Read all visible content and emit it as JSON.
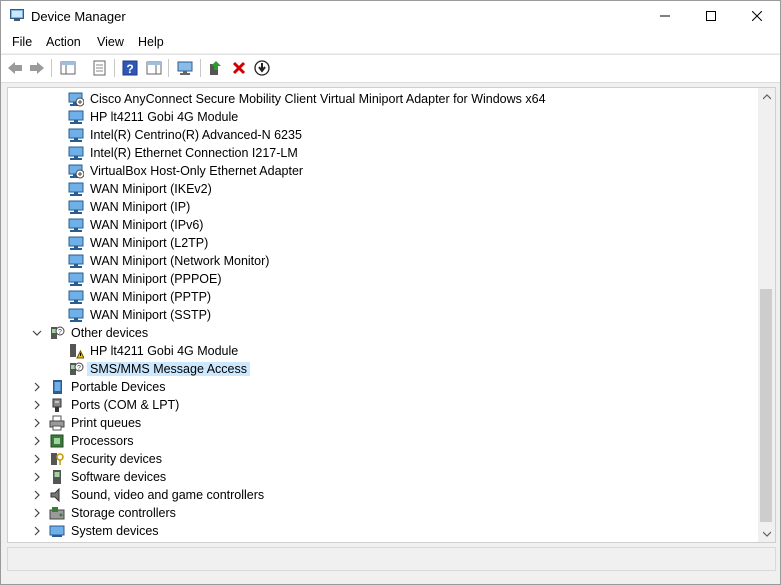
{
  "window": {
    "title": "Device Manager"
  },
  "menu": {
    "file": "File",
    "action": "Action",
    "view": "View",
    "help": "Help"
  },
  "toolbar": {
    "buttons": [
      "back-arrow-icon",
      "forward-arrow-icon",
      "show-hide-console-tree-icon",
      "properties-icon",
      "help-icon",
      "action-pane-icon",
      "scan-hardware-icon",
      "update-driver-icon",
      "uninstall-icon",
      "disable-device-icon"
    ]
  },
  "tree": {
    "network_adapters": [
      "Cisco AnyConnect Secure Mobility Client Virtual Miniport Adapter for Windows x64",
      "HP lt4211 Gobi 4G Module",
      "Intel(R) Centrino(R) Advanced-N 6235",
      "Intel(R) Ethernet Connection I217-LM",
      "VirtualBox Host-Only Ethernet Adapter",
      "WAN Miniport (IKEv2)",
      "WAN Miniport (IP)",
      "WAN Miniport (IPv6)",
      "WAN Miniport (L2TP)",
      "WAN Miniport (Network Monitor)",
      "WAN Miniport (PPPOE)",
      "WAN Miniport (PPTP)",
      "WAN Miniport (SSTP)"
    ],
    "other_devices": {
      "label": "Other devices",
      "children": [
        "HP lt4211 Gobi 4G Module",
        "SMS/MMS Message Access"
      ],
      "selected": "SMS/MMS Message Access"
    },
    "categories": [
      "Portable Devices",
      "Ports (COM & LPT)",
      "Print queues",
      "Processors",
      "Security devices",
      "Software devices",
      "Sound, video and game controllers",
      "Storage controllers",
      "System devices"
    ]
  },
  "colors": {
    "selection": "#cce8ff",
    "uninstall_red": "#d40000",
    "green": "#2e9b2e",
    "blue": "#1a5fb4"
  }
}
